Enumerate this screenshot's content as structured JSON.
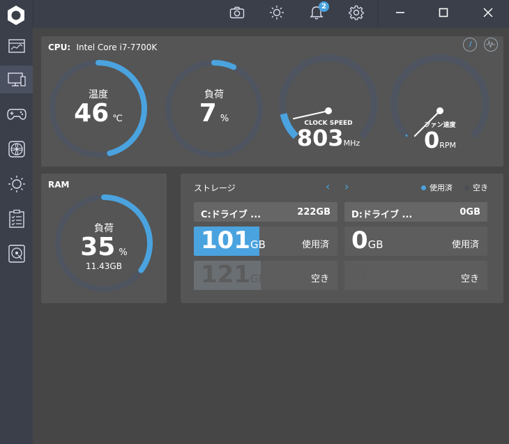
{
  "titlebar": {
    "icons": [
      "camera-icon",
      "brightness-icon",
      "bell-icon",
      "gear-icon"
    ],
    "notification_count": "2",
    "window_controls": [
      "minimize-icon",
      "maximize-icon",
      "close-icon"
    ]
  },
  "sidebar": {
    "items": [
      "dashboard-icon",
      "monitor-icon",
      "gamepad-icon",
      "fan-icon",
      "light-icon",
      "clipboard-icon",
      "disk-icon"
    ],
    "active_index": 1
  },
  "cpu": {
    "label": "CPU:",
    "model": "Intel Core i7-7700K",
    "temp": {
      "label": "温度",
      "value": "46",
      "unit": "℃",
      "fraction": 0.46
    },
    "load": {
      "label": "負荷",
      "value": "7",
      "unit": "%",
      "fraction": 0.07
    },
    "clock": {
      "label": "CLOCK SPEED",
      "value": "803",
      "unit": "MHz",
      "fraction": 0.12
    },
    "fan": {
      "label": "ファン速度",
      "value": "0",
      "unit": "RPM",
      "fraction": 0.0
    }
  },
  "ram": {
    "label": "RAM",
    "load_label": "負荷",
    "value": "35",
    "unit": "%",
    "amount": "11.43GB",
    "fraction": 0.35
  },
  "storage": {
    "title": "ストレージ",
    "legend_used": "使用済",
    "legend_free": "空き",
    "colors": {
      "used": "#4aa3df",
      "free": "#6a6f74"
    },
    "drives": [
      {
        "name": "C:ドライブ ...",
        "size": "222GB",
        "used": "101",
        "free": "121",
        "unit": "GB",
        "used_label": "使用済",
        "free_label": "空き",
        "used_fraction": 0.455
      },
      {
        "name": "D:ドライブ ...",
        "size": "0GB",
        "used": "0",
        "free": "0",
        "unit": "GB",
        "used_label": "使用済",
        "free_label": "空き",
        "used_fraction": 0.0
      }
    ]
  }
}
